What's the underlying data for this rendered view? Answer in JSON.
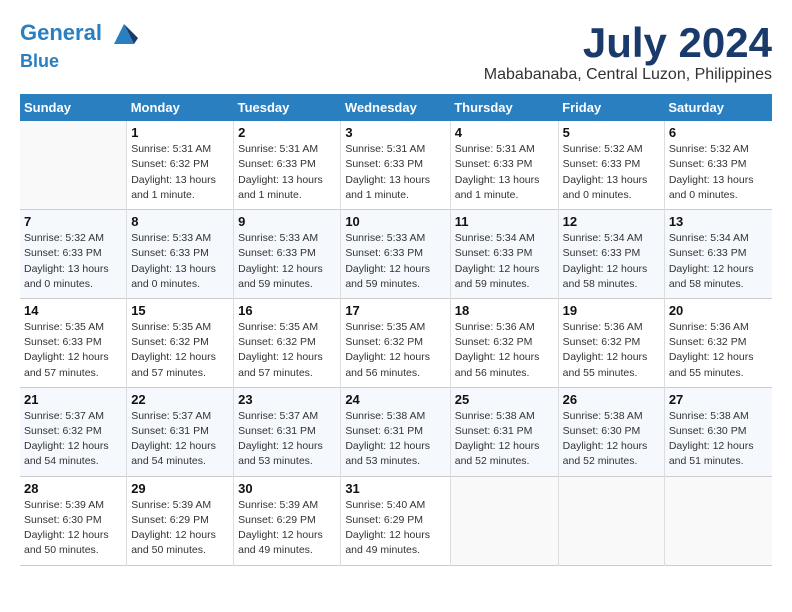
{
  "header": {
    "logo_line1": "General",
    "logo_line2": "Blue",
    "month": "July 2024",
    "location": "Mababanaba, Central Luzon, Philippines"
  },
  "days_of_week": [
    "Sunday",
    "Monday",
    "Tuesday",
    "Wednesday",
    "Thursday",
    "Friday",
    "Saturday"
  ],
  "weeks": [
    [
      {
        "num": "",
        "sunrise": "",
        "sunset": "",
        "daylight": "",
        "empty": true
      },
      {
        "num": "1",
        "sunrise": "Sunrise: 5:31 AM",
        "sunset": "Sunset: 6:32 PM",
        "daylight": "Daylight: 13 hours and 1 minute."
      },
      {
        "num": "2",
        "sunrise": "Sunrise: 5:31 AM",
        "sunset": "Sunset: 6:33 PM",
        "daylight": "Daylight: 13 hours and 1 minute."
      },
      {
        "num": "3",
        "sunrise": "Sunrise: 5:31 AM",
        "sunset": "Sunset: 6:33 PM",
        "daylight": "Daylight: 13 hours and 1 minute."
      },
      {
        "num": "4",
        "sunrise": "Sunrise: 5:31 AM",
        "sunset": "Sunset: 6:33 PM",
        "daylight": "Daylight: 13 hours and 1 minute."
      },
      {
        "num": "5",
        "sunrise": "Sunrise: 5:32 AM",
        "sunset": "Sunset: 6:33 PM",
        "daylight": "Daylight: 13 hours and 0 minutes."
      },
      {
        "num": "6",
        "sunrise": "Sunrise: 5:32 AM",
        "sunset": "Sunset: 6:33 PM",
        "daylight": "Daylight: 13 hours and 0 minutes."
      }
    ],
    [
      {
        "num": "7",
        "sunrise": "Sunrise: 5:32 AM",
        "sunset": "Sunset: 6:33 PM",
        "daylight": "Daylight: 13 hours and 0 minutes."
      },
      {
        "num": "8",
        "sunrise": "Sunrise: 5:33 AM",
        "sunset": "Sunset: 6:33 PM",
        "daylight": "Daylight: 13 hours and 0 minutes."
      },
      {
        "num": "9",
        "sunrise": "Sunrise: 5:33 AM",
        "sunset": "Sunset: 6:33 PM",
        "daylight": "Daylight: 12 hours and 59 minutes."
      },
      {
        "num": "10",
        "sunrise": "Sunrise: 5:33 AM",
        "sunset": "Sunset: 6:33 PM",
        "daylight": "Daylight: 12 hours and 59 minutes."
      },
      {
        "num": "11",
        "sunrise": "Sunrise: 5:34 AM",
        "sunset": "Sunset: 6:33 PM",
        "daylight": "Daylight: 12 hours and 59 minutes."
      },
      {
        "num": "12",
        "sunrise": "Sunrise: 5:34 AM",
        "sunset": "Sunset: 6:33 PM",
        "daylight": "Daylight: 12 hours and 58 minutes."
      },
      {
        "num": "13",
        "sunrise": "Sunrise: 5:34 AM",
        "sunset": "Sunset: 6:33 PM",
        "daylight": "Daylight: 12 hours and 58 minutes."
      }
    ],
    [
      {
        "num": "14",
        "sunrise": "Sunrise: 5:35 AM",
        "sunset": "Sunset: 6:33 PM",
        "daylight": "Daylight: 12 hours and 57 minutes."
      },
      {
        "num": "15",
        "sunrise": "Sunrise: 5:35 AM",
        "sunset": "Sunset: 6:32 PM",
        "daylight": "Daylight: 12 hours and 57 minutes."
      },
      {
        "num": "16",
        "sunrise": "Sunrise: 5:35 AM",
        "sunset": "Sunset: 6:32 PM",
        "daylight": "Daylight: 12 hours and 57 minutes."
      },
      {
        "num": "17",
        "sunrise": "Sunrise: 5:35 AM",
        "sunset": "Sunset: 6:32 PM",
        "daylight": "Daylight: 12 hours and 56 minutes."
      },
      {
        "num": "18",
        "sunrise": "Sunrise: 5:36 AM",
        "sunset": "Sunset: 6:32 PM",
        "daylight": "Daylight: 12 hours and 56 minutes."
      },
      {
        "num": "19",
        "sunrise": "Sunrise: 5:36 AM",
        "sunset": "Sunset: 6:32 PM",
        "daylight": "Daylight: 12 hours and 55 minutes."
      },
      {
        "num": "20",
        "sunrise": "Sunrise: 5:36 AM",
        "sunset": "Sunset: 6:32 PM",
        "daylight": "Daylight: 12 hours and 55 minutes."
      }
    ],
    [
      {
        "num": "21",
        "sunrise": "Sunrise: 5:37 AM",
        "sunset": "Sunset: 6:32 PM",
        "daylight": "Daylight: 12 hours and 54 minutes."
      },
      {
        "num": "22",
        "sunrise": "Sunrise: 5:37 AM",
        "sunset": "Sunset: 6:31 PM",
        "daylight": "Daylight: 12 hours and 54 minutes."
      },
      {
        "num": "23",
        "sunrise": "Sunrise: 5:37 AM",
        "sunset": "Sunset: 6:31 PM",
        "daylight": "Daylight: 12 hours and 53 minutes."
      },
      {
        "num": "24",
        "sunrise": "Sunrise: 5:38 AM",
        "sunset": "Sunset: 6:31 PM",
        "daylight": "Daylight: 12 hours and 53 minutes."
      },
      {
        "num": "25",
        "sunrise": "Sunrise: 5:38 AM",
        "sunset": "Sunset: 6:31 PM",
        "daylight": "Daylight: 12 hours and 52 minutes."
      },
      {
        "num": "26",
        "sunrise": "Sunrise: 5:38 AM",
        "sunset": "Sunset: 6:30 PM",
        "daylight": "Daylight: 12 hours and 52 minutes."
      },
      {
        "num": "27",
        "sunrise": "Sunrise: 5:38 AM",
        "sunset": "Sunset: 6:30 PM",
        "daylight": "Daylight: 12 hours and 51 minutes."
      }
    ],
    [
      {
        "num": "28",
        "sunrise": "Sunrise: 5:39 AM",
        "sunset": "Sunset: 6:30 PM",
        "daylight": "Daylight: 12 hours and 50 minutes."
      },
      {
        "num": "29",
        "sunrise": "Sunrise: 5:39 AM",
        "sunset": "Sunset: 6:29 PM",
        "daylight": "Daylight: 12 hours and 50 minutes."
      },
      {
        "num": "30",
        "sunrise": "Sunrise: 5:39 AM",
        "sunset": "Sunset: 6:29 PM",
        "daylight": "Daylight: 12 hours and 49 minutes."
      },
      {
        "num": "31",
        "sunrise": "Sunrise: 5:40 AM",
        "sunset": "Sunset: 6:29 PM",
        "daylight": "Daylight: 12 hours and 49 minutes."
      },
      {
        "num": "",
        "sunrise": "",
        "sunset": "",
        "daylight": "",
        "empty": true
      },
      {
        "num": "",
        "sunrise": "",
        "sunset": "",
        "daylight": "",
        "empty": true
      },
      {
        "num": "",
        "sunrise": "",
        "sunset": "",
        "daylight": "",
        "empty": true
      }
    ]
  ]
}
